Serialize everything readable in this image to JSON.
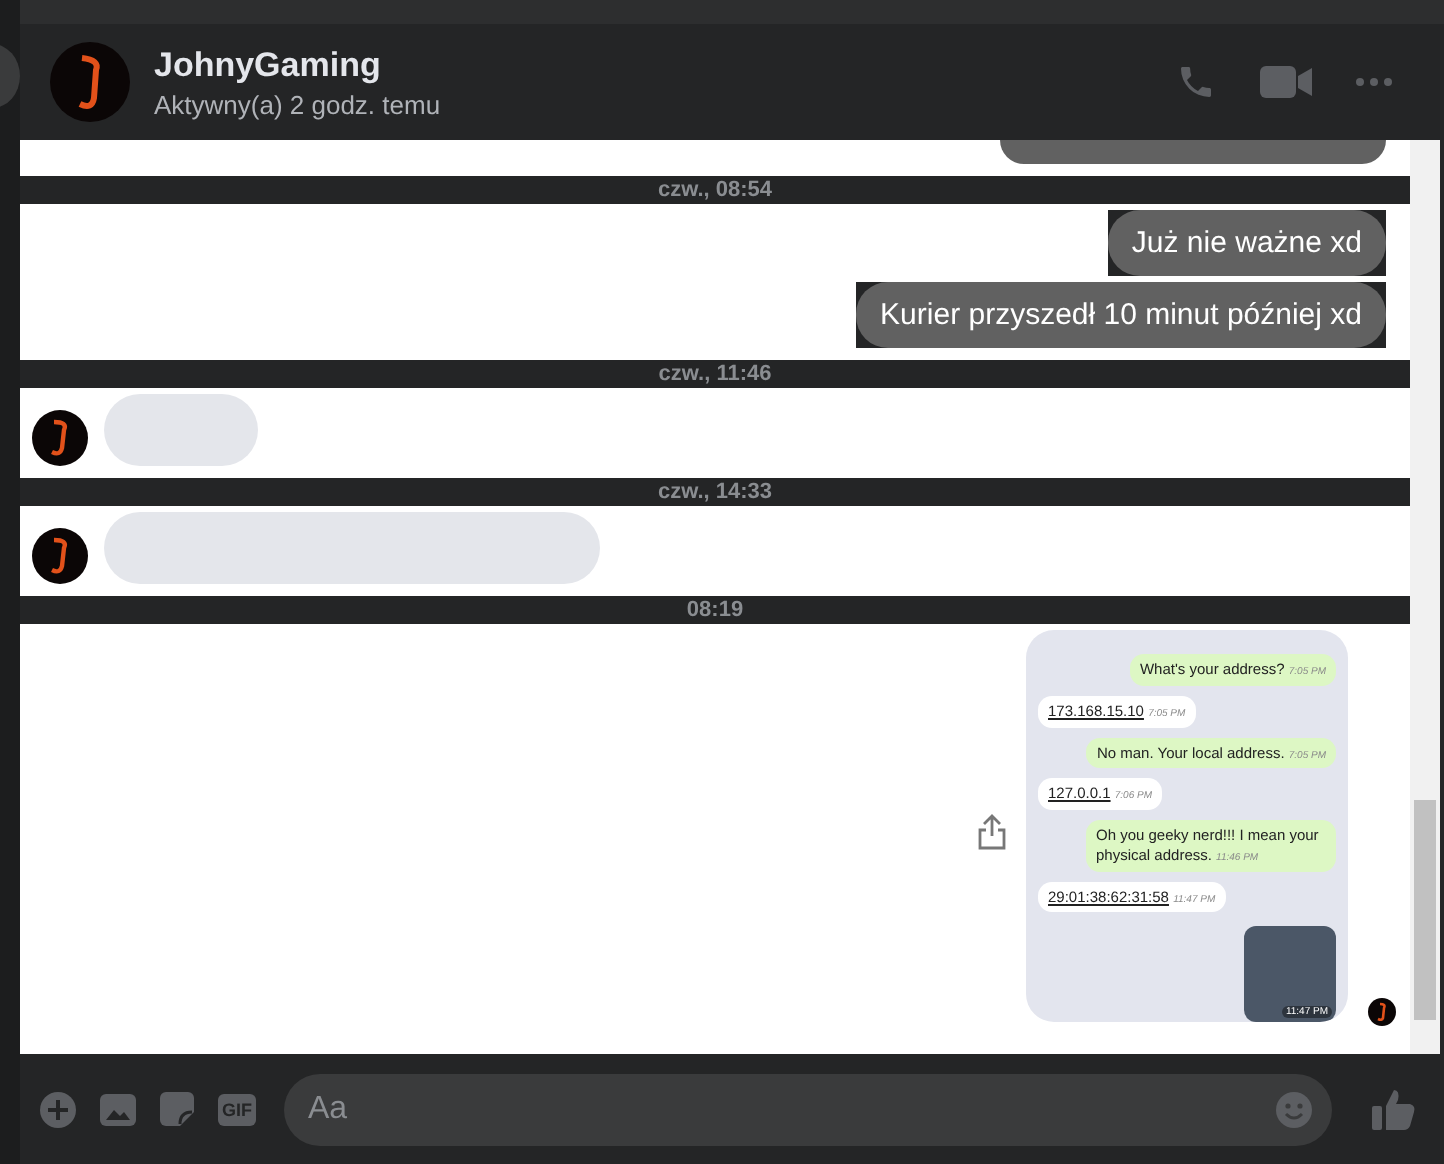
{
  "header": {
    "name": "JohnyGaming",
    "status": "Aktywny(a) 2 godz. temu"
  },
  "sections": [
    {
      "messages": [
        {
          "kind": "cut"
        }
      ]
    },
    {
      "time": "czw., 08:54",
      "messages": [
        {
          "kind": "outgoing",
          "text": "Już nie ważne xd"
        },
        {
          "kind": "outgoing",
          "text": "Kurier przyszedł 10 minut później xd"
        }
      ]
    },
    {
      "time": "czw., 11:46",
      "messages": [
        {
          "kind": "hidden_short"
        }
      ]
    },
    {
      "time": "czw., 14:33",
      "messages": [
        {
          "kind": "hidden_long"
        }
      ]
    },
    {
      "time": "08:19",
      "messages": [
        {
          "kind": "screenshot"
        }
      ]
    }
  ],
  "screenshot": {
    "messages": [
      {
        "kind": "out",
        "text": "What's your address?",
        "time": "7:05 PM"
      },
      {
        "kind": "in",
        "text": "173.168.15.10",
        "time": "7:05 PM"
      },
      {
        "kind": "out",
        "text": "No man. Your local address.",
        "time": "7:05 PM"
      },
      {
        "kind": "in",
        "text": "127.0.0.1",
        "time": "7:06 PM"
      },
      {
        "kind": "out",
        "text": "Oh you geeky nerd!!! I mean your physical address.",
        "time": "11:46 PM"
      },
      {
        "kind": "in",
        "text": "29:01:38:62:31:58",
        "time": "11:47 PM"
      },
      {
        "kind": "sticker",
        "time": "11:47 PM"
      }
    ]
  },
  "composer": {
    "gif_label": "GIF",
    "placeholder": "Aa"
  }
}
